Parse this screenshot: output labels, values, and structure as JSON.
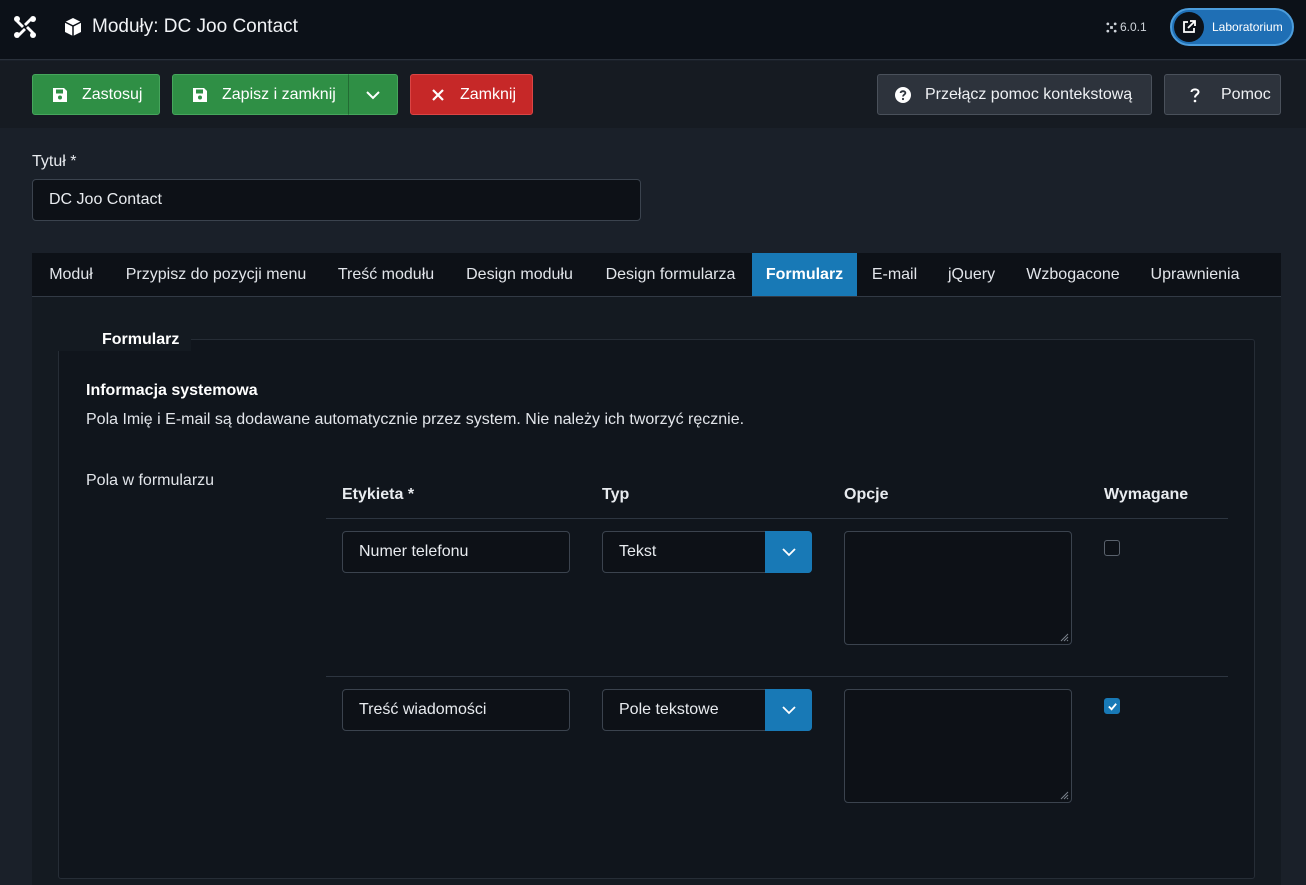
{
  "header": {
    "title": "Moduły: DC Joo Contact",
    "version": "6.0.1",
    "lab_label": "Laboratorium"
  },
  "toolbar": {
    "apply": "Zastosuj",
    "save_close": "Zapisz i zamknij",
    "close": "Zamknij",
    "context_help": "Przełącz pomoc kontekstową",
    "help": "Pomoc"
  },
  "form": {
    "title_label": "Tytuł *",
    "title_value": "DC Joo Contact"
  },
  "tabs": [
    {
      "label": "Moduł"
    },
    {
      "label": "Przypisz do pozycji menu"
    },
    {
      "label": "Treść modułu"
    },
    {
      "label": "Design modułu"
    },
    {
      "label": "Design formularza"
    },
    {
      "label": "Formularz"
    },
    {
      "label": "E-mail"
    },
    {
      "label": "jQuery"
    },
    {
      "label": "Wzbogacone"
    },
    {
      "label": "Uprawnienia"
    }
  ],
  "active_tab": "Formularz",
  "fieldset": {
    "legend": "Formularz",
    "info_title": "Informacja systemowa",
    "info_text": "Pola Imię i E-mail są dodawane automatycznie przez system. Nie należy ich tworzyć ręcznie.",
    "fields_label": "Pola w formularzu"
  },
  "table": {
    "headers": [
      "Etykieta *",
      "Typ",
      "Opcje",
      "Wymagane"
    ],
    "rows": [
      {
        "label": "Numer telefonu",
        "type": "Tekst",
        "options": "",
        "required": false
      },
      {
        "label": "Treść wiadomości",
        "type": "Pole tekstowe",
        "options": "",
        "required": true
      }
    ]
  },
  "colors": {
    "success": "#2f8f45",
    "danger": "#c62828",
    "accent": "#1879b6",
    "background": "#1a2029"
  }
}
